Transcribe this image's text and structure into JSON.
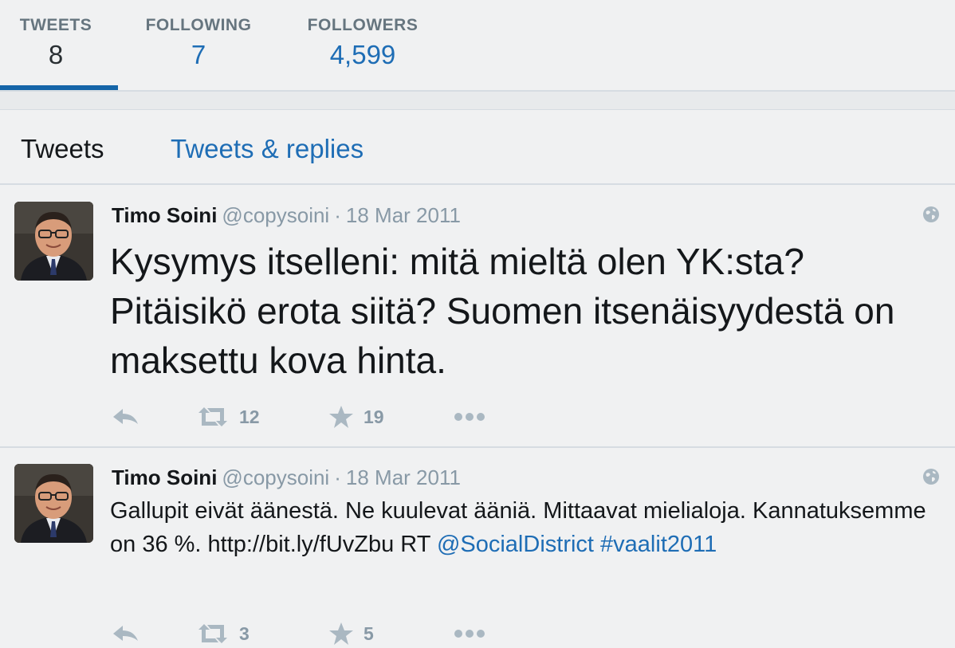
{
  "stats": [
    {
      "label": "TWEETS",
      "value": "8"
    },
    {
      "label": "FOLLOWING",
      "value": "7"
    },
    {
      "label": "FOLLOWERS",
      "value": "4,599"
    }
  ],
  "tabs": [
    {
      "label": "Tweets"
    },
    {
      "label": "Tweets & replies"
    }
  ],
  "tweets": [
    {
      "name": "Timo Soini",
      "handle": "@copysoini",
      "separator": "·",
      "date": "18 Mar 2011",
      "text": "Kysymys itselleni: mitä mieltä olen YK:sta? Pitäisikö erota siitä? Suomen itsenäisyydestä on maksettu kova hinta.",
      "retweets": "12",
      "favorites": "19"
    },
    {
      "name": "Timo Soini",
      "handle": "@copysoini",
      "separator": "·",
      "date": "18 Mar 2011",
      "text_plain": "Gallupit eivät äänestä. Ne kuulevat ääniä. Mittaavat mielialoja. Kannatuksemme on 36 %. http://bit.ly/fUvZbu RT ",
      "mention": "@SocialDistrict",
      "hashtag": "#vaalit2011",
      "retweets": "3",
      "favorites": "5"
    }
  ],
  "colors": {
    "background": "#f0f1f2",
    "accent": "#1e6db5",
    "active_underline": "#1565a8",
    "muted": "#8899a6"
  },
  "icons": [
    "reply-icon",
    "retweet-icon",
    "favorite-icon",
    "more-icon",
    "globe-icon"
  ]
}
